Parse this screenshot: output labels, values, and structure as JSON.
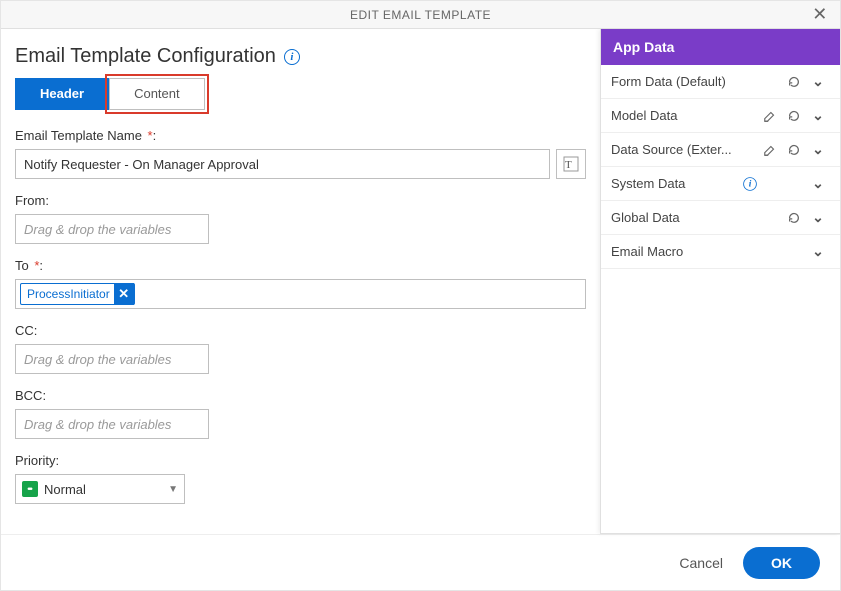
{
  "title": "EDIT EMAIL TEMPLATE",
  "heading": "Email Template Configuration",
  "tabs": {
    "header": "Header",
    "content": "Content"
  },
  "labels": {
    "template_name": "Email Template Name",
    "from": "From:",
    "to": "To",
    "cc": "CC:",
    "bcc": "BCC:",
    "priority": "Priority:"
  },
  "values": {
    "template_name": "Notify Requester - On Manager Approval",
    "to_chip": "ProcessInitiator",
    "priority": "Normal"
  },
  "placeholders": {
    "drag": "Drag & drop the variables"
  },
  "sidepanel": {
    "title": "App Data",
    "items": [
      {
        "label": "Form Data (Default)",
        "edit": false,
        "refresh": true
      },
      {
        "label": "Model Data",
        "edit": true,
        "refresh": true
      },
      {
        "label": "Data Source (External)",
        "display": "Data Source (Exter...",
        "edit": true,
        "refresh": true
      },
      {
        "label": "System Data",
        "info": true
      },
      {
        "label": "Global Data",
        "refresh": true
      },
      {
        "label": "Email Macro"
      }
    ]
  },
  "footer": {
    "cancel": "Cancel",
    "ok": "OK"
  }
}
